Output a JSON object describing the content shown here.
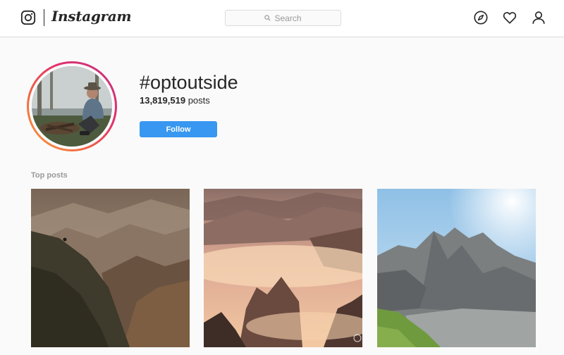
{
  "header": {
    "wordmark": "Instagram",
    "search_placeholder": "Search",
    "icons": [
      "instagram-glyph-icon",
      "search-icon",
      "compass-icon",
      "heart-icon",
      "person-icon"
    ]
  },
  "hashtag": {
    "name": "#optoutside",
    "post_count": "13,819,519",
    "post_unit": "posts",
    "follow_label": "Follow"
  },
  "top_posts": {
    "label": "Top posts",
    "items": [
      {
        "subject": "misty mountain ridge with animal silhouette"
      },
      {
        "subject": "sunrise over fog-filled forested valley"
      },
      {
        "subject": "rocky mountain peak with green slope and blue sky"
      }
    ]
  },
  "colors": {
    "accent": "#3897f0",
    "text": "#262626",
    "muted": "#999999",
    "border": "#dbdbdb",
    "background": "#fafafa"
  }
}
